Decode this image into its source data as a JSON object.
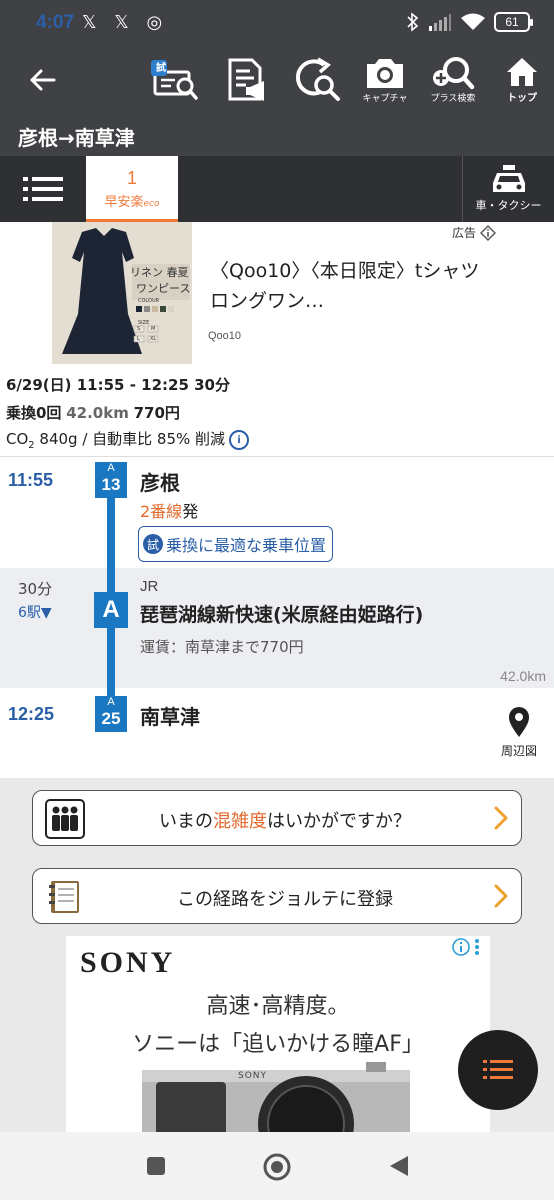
{
  "status_bar": {
    "time": "4:07",
    "notifications": "𝕏 𝕏 ◎",
    "battery": "61"
  },
  "toolbar": {
    "trial_badge": "試",
    "capture_label": "キャプチャ",
    "plus_search_label": "プラス検索",
    "top_label": "トップ"
  },
  "page": {
    "title": "彦根→南草津"
  },
  "tabs": {
    "route_number": "1",
    "route_keywords": "早安楽",
    "eco_label": "eco",
    "car_taxi_label": "車・タクシー"
  },
  "ad_top": {
    "label": "広告",
    "title": "〈Qoo10〉〈本日限定〉tシャツロングワン…",
    "source": "Qoo10",
    "image_text_1": "リネン 春夏",
    "image_text_2": "ワンピース",
    "image_colour": "COLOUR",
    "image_size": "SIZE",
    "image_sizes": [
      "S",
      "M",
      "L",
      "XL"
    ]
  },
  "summary": {
    "datetime": "6/29(日) 11:55 - 12:25 30分",
    "transfers": "乗換0回",
    "distance": "42.0km",
    "fare": "770円",
    "co2_prefix": "CO",
    "co2_sub": "2",
    "co2_text": " 840g / 自動車比 85% 削減",
    "info_icon": "i"
  },
  "route": {
    "depart_time": "11:55",
    "depart_line_code": "A",
    "depart_station_no": "13",
    "depart_station": "彦根",
    "platform_highlight": "2番線",
    "platform_suffix": "発",
    "position_badge": "試",
    "position_label": "乗換に最適な乗車位置",
    "duration": "30分",
    "stops": "6駅▼",
    "line_badge": "A",
    "operator": "JR",
    "line_name": "琵琶湖線新快速(米原経由姫路行)",
    "fare_text": "運賃：南草津まで770円",
    "distance": "42.0km",
    "arrive_time": "12:25",
    "arrive_line_code": "A",
    "arrive_station_no": "25",
    "arrive_station": "南草津",
    "map_label": "周辺図"
  },
  "actions": {
    "crowd_prefix": "いまの",
    "crowd_highlight": "混雑度",
    "crowd_suffix": "はいかがですか？",
    "jorudan_label": "この経路をジョルテに登録"
  },
  "ad_bottom": {
    "brand": "SONY",
    "tagline1": "高速･高精度。",
    "tagline2": "ソニーは「追いかける瞳AF」",
    "camera_brand": "SONY"
  },
  "colors": {
    "header_bg": "#3f4145",
    "accent_orange": "#e36a2e",
    "line_blue": "#1a78c2",
    "link_blue": "#2a5fa8"
  }
}
